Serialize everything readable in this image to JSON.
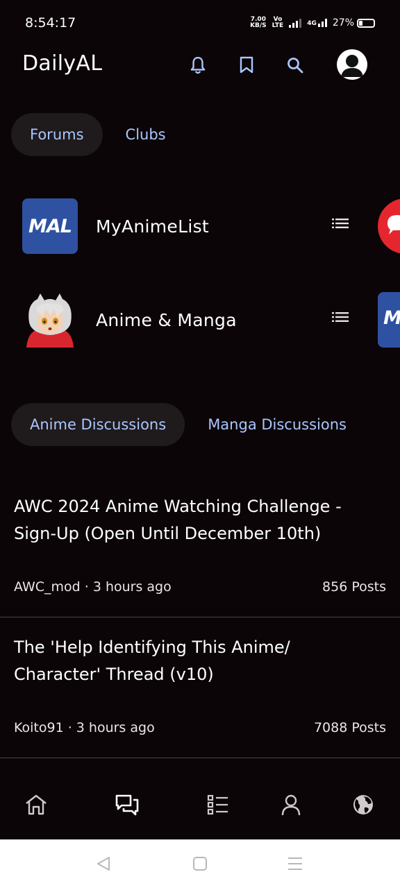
{
  "status_bar": {
    "time": "8:54:17",
    "speed_value": "7.00",
    "speed_unit": "KB/S",
    "volte_top": "Vo",
    "volte_bottom": "LTE",
    "network": "4G",
    "battery_percent": "27%",
    "battery_level": 0.27
  },
  "app_bar": {
    "title": "DailyAL",
    "icons": [
      "bell-icon",
      "bookmark-icon",
      "search-icon",
      "avatar"
    ]
  },
  "forum_tabs": [
    {
      "label": "Forums",
      "active": true
    },
    {
      "label": "Clubs",
      "active": false
    }
  ],
  "forums": [
    {
      "name": "MyAnimeList",
      "logo_text": "MAL"
    },
    {
      "name": "Anime & Manga"
    }
  ],
  "discussion_tabs": [
    {
      "label": "Anime Discussions",
      "active": true
    },
    {
      "label": "Manga Discussions",
      "active": false
    }
  ],
  "topics": [
    {
      "title": "AWC 2024 Anime Watching Challenge - Sign-Up (Open Until December 10th)",
      "meta": "AWC_mod · 3 hours ago",
      "posts": "856 Posts"
    },
    {
      "title": "The 'Help Identifying This Anime/ Character' Thread (v10)",
      "meta": "Koito91 · 3 hours ago",
      "posts": "7088 Posts"
    }
  ],
  "bottom_nav": [
    "home-icon",
    "forum-icon",
    "list-icon",
    "profile-icon",
    "globe-icon"
  ],
  "colors": {
    "background": "#0c0507",
    "accent": "#a9c7ff",
    "mal_blue": "#2e51a2"
  }
}
